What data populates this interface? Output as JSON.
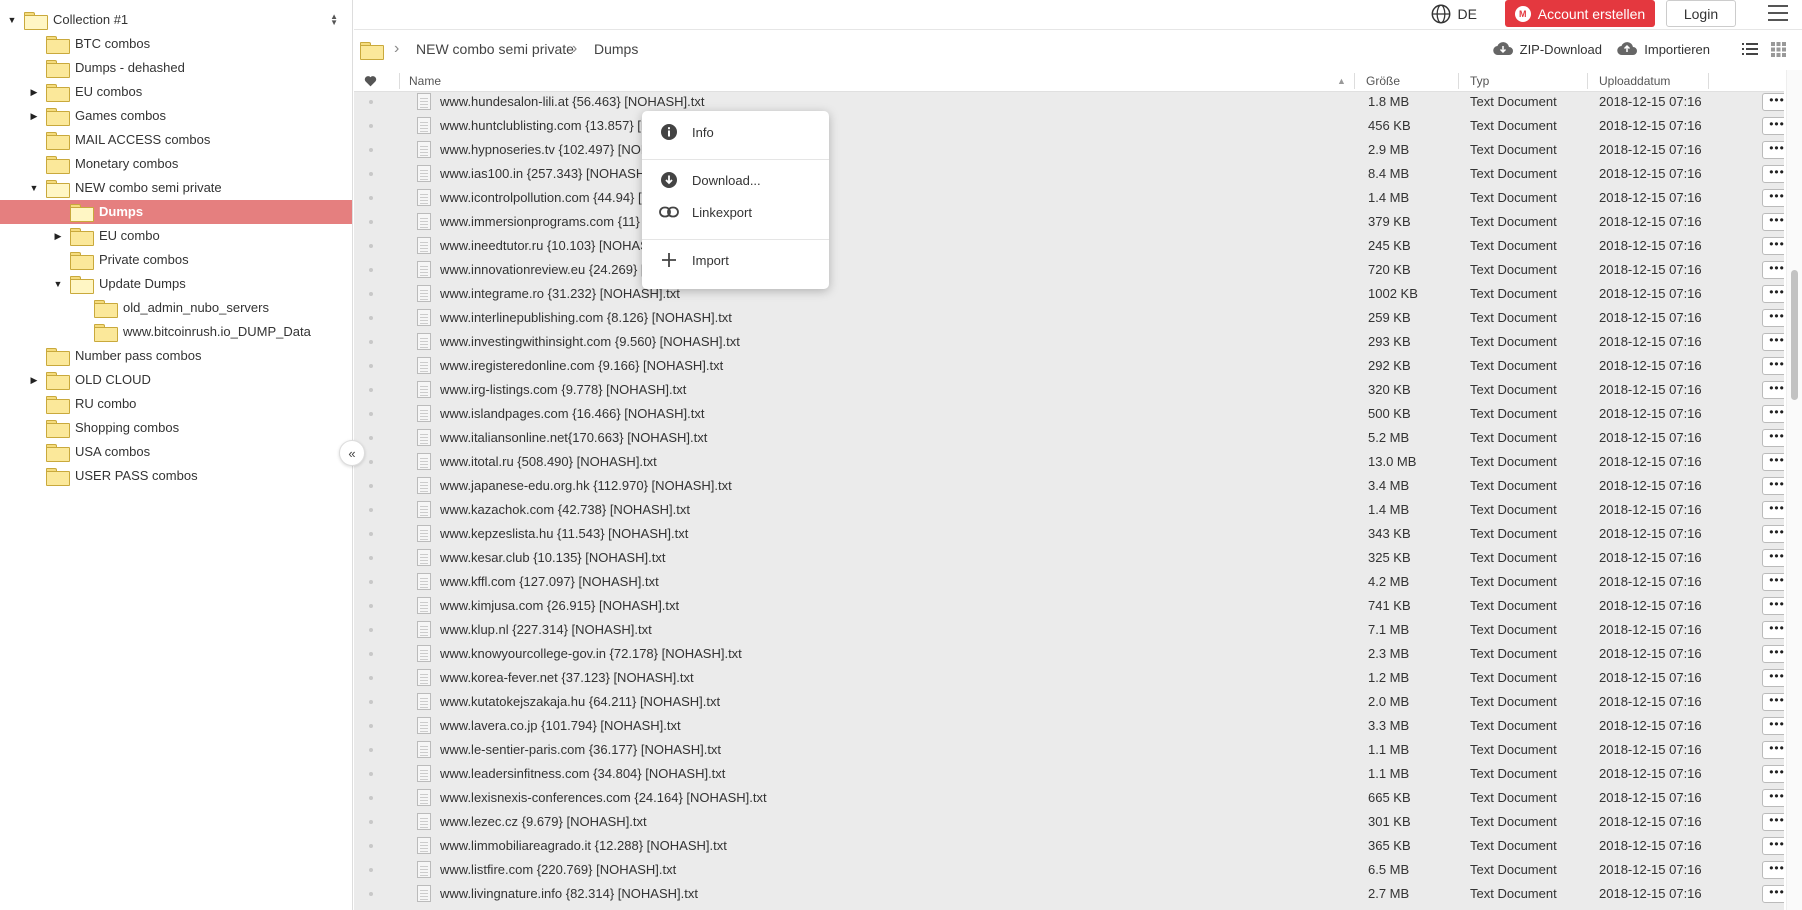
{
  "sidebar": {
    "items": [
      {
        "label": "Collection #1",
        "caret": "open",
        "open": true
      },
      {
        "label": "BTC combos"
      },
      {
        "label": "Dumps - dehashed"
      },
      {
        "label": "EU combos",
        "caret": "closed"
      },
      {
        "label": "Games combos",
        "caret": "closed"
      },
      {
        "label": "MAIL ACCESS combos"
      },
      {
        "label": "Monetary combos"
      },
      {
        "label": "NEW combo semi private",
        "caret": "open",
        "open": true
      },
      {
        "label": "Dumps",
        "open": true,
        "selected": true
      },
      {
        "label": "EU combo",
        "caret": "closed"
      },
      {
        "label": "Private combos"
      },
      {
        "label": "Update Dumps",
        "caret": "open",
        "open": true
      },
      {
        "label": "old_admin_nubo_servers"
      },
      {
        "label": "www.bitcoinrush.io_DUMP_Data"
      },
      {
        "label": "Number pass combos"
      },
      {
        "label": "OLD CLOUD",
        "caret": "closed"
      },
      {
        "label": "RU combo"
      },
      {
        "label": "Shopping combos"
      },
      {
        "label": "USA combos"
      },
      {
        "label": "USER PASS combos"
      }
    ],
    "collapse_icon": "double-chevron-left-icon"
  },
  "topbar": {
    "language": "DE",
    "account_button": "Account erstellen",
    "login_button": "Login"
  },
  "breadcrumb": {
    "items": [
      "NEW combo semi private",
      "Dumps"
    ]
  },
  "toolbar": {
    "zip_download": "ZIP-Download",
    "import": "Importieren"
  },
  "table": {
    "columns": {
      "name": "Name",
      "size": "Größe",
      "type": "Typ",
      "date": "Uploaddatum"
    },
    "rows": [
      {
        "name": "www.hundesalon-lili.at {56.463} [NOHASH].txt",
        "size": "1.8 MB",
        "type": "Text Document",
        "date": "2018-12-15 07:16"
      },
      {
        "name": "www.huntclublisting.com {13.857} [NOHASH].txt",
        "size": "456 KB",
        "type": "Text Document",
        "date": "2018-12-15 07:16"
      },
      {
        "name": "www.hypnoseries.tv {102.497} [NOHASH].txt",
        "size": "2.9 MB",
        "type": "Text Document",
        "date": "2018-12-15 07:16"
      },
      {
        "name": "www.ias100.in {257.343} [NOHASH].txt",
        "size": "8.4 MB",
        "type": "Text Document",
        "date": "2018-12-15 07:16"
      },
      {
        "name": "www.icontrolpollution.com {44.94} [NOHASH].txt",
        "size": "1.4 MB",
        "type": "Text Document",
        "date": "2018-12-15 07:16"
      },
      {
        "name": "www.immersionprograms.com {11} [NOHASH].txt",
        "size": "379 KB",
        "type": "Text Document",
        "date": "2018-12-15 07:16"
      },
      {
        "name": "www.ineedtutor.ru {10.103} [NOHASH].txt",
        "size": "245 KB",
        "type": "Text Document",
        "date": "2018-12-15 07:16"
      },
      {
        "name": "www.innovationreview.eu {24.269} [NOHASH].txt",
        "size": "720 KB",
        "type": "Text Document",
        "date": "2018-12-15 07:16"
      },
      {
        "name": "www.integrame.ro {31.232} [NOHASH].txt",
        "size": "1002 KB",
        "type": "Text Document",
        "date": "2018-12-15 07:16"
      },
      {
        "name": "www.interlinepublishing.com {8.126} [NOHASH].txt",
        "size": "259 KB",
        "type": "Text Document",
        "date": "2018-12-15 07:16"
      },
      {
        "name": "www.investingwithinsight.com {9.560} [NOHASH].txt",
        "size": "293 KB",
        "type": "Text Document",
        "date": "2018-12-15 07:16"
      },
      {
        "name": "www.iregisteredonline.com {9.166} [NOHASH].txt",
        "size": "292 KB",
        "type": "Text Document",
        "date": "2018-12-15 07:16"
      },
      {
        "name": "www.irg-listings.com {9.778} [NOHASH].txt",
        "size": "320 KB",
        "type": "Text Document",
        "date": "2018-12-15 07:16"
      },
      {
        "name": "www.islandpages.com {16.466} [NOHASH].txt",
        "size": "500 KB",
        "type": "Text Document",
        "date": "2018-12-15 07:16"
      },
      {
        "name": "www.italiansonline.net{170.663} [NOHASH].txt",
        "size": "5.2 MB",
        "type": "Text Document",
        "date": "2018-12-15 07:16"
      },
      {
        "name": "www.itotal.ru {508.490} [NOHASH].txt",
        "size": "13.0 MB",
        "type": "Text Document",
        "date": "2018-12-15 07:16"
      },
      {
        "name": "www.japanese-edu.org.hk {112.970} [NOHASH].txt",
        "size": "3.4 MB",
        "type": "Text Document",
        "date": "2018-12-15 07:16"
      },
      {
        "name": "www.kazachok.com {42.738} [NOHASH].txt",
        "size": "1.4 MB",
        "type": "Text Document",
        "date": "2018-12-15 07:16"
      },
      {
        "name": "www.kepzeslista.hu {11.543} [NOHASH].txt",
        "size": "343 KB",
        "type": "Text Document",
        "date": "2018-12-15 07:16"
      },
      {
        "name": "www.kesar.club {10.135} [NOHASH].txt",
        "size": "325 KB",
        "type": "Text Document",
        "date": "2018-12-15 07:16"
      },
      {
        "name": "www.kffl.com {127.097} [NOHASH].txt",
        "size": "4.2 MB",
        "type": "Text Document",
        "date": "2018-12-15 07:16"
      },
      {
        "name": "www.kimjusa.com {26.915} [NOHASH].txt",
        "size": "741 KB",
        "type": "Text Document",
        "date": "2018-12-15 07:16"
      },
      {
        "name": "www.klup.nl {227.314} [NOHASH].txt",
        "size": "7.1 MB",
        "type": "Text Document",
        "date": "2018-12-15 07:16"
      },
      {
        "name": "www.knowyourcollege-gov.in {72.178} [NOHASH].txt",
        "size": "2.3 MB",
        "type": "Text Document",
        "date": "2018-12-15 07:16"
      },
      {
        "name": "www.korea-fever.net {37.123} [NOHASH].txt",
        "size": "1.2 MB",
        "type": "Text Document",
        "date": "2018-12-15 07:16"
      },
      {
        "name": "www.kutatokejszakaja.hu {64.211} [NOHASH].txt",
        "size": "2.0 MB",
        "type": "Text Document",
        "date": "2018-12-15 07:16"
      },
      {
        "name": "www.lavera.co.jp {101.794} [NOHASH].txt",
        "size": "3.3 MB",
        "type": "Text Document",
        "date": "2018-12-15 07:16"
      },
      {
        "name": "www.le-sentier-paris.com {36.177} [NOHASH].txt",
        "size": "1.1 MB",
        "type": "Text Document",
        "date": "2018-12-15 07:16"
      },
      {
        "name": "www.leadersinfitness.com {34.804} [NOHASH].txt",
        "size": "1.1 MB",
        "type": "Text Document",
        "date": "2018-12-15 07:16"
      },
      {
        "name": "www.lexisnexis-conferences.com {24.164} [NOHASH].txt",
        "size": "665 KB",
        "type": "Text Document",
        "date": "2018-12-15 07:16"
      },
      {
        "name": "www.lezec.cz {9.679} [NOHASH].txt",
        "size": "301 KB",
        "type": "Text Document",
        "date": "2018-12-15 07:16"
      },
      {
        "name": "www.limmobiliareagrado.it {12.288} [NOHASH].txt",
        "size": "365 KB",
        "type": "Text Document",
        "date": "2018-12-15 07:16"
      },
      {
        "name": "www.listfire.com {220.769} [NOHASH].txt",
        "size": "6.5 MB",
        "type": "Text Document",
        "date": "2018-12-15 07:16"
      },
      {
        "name": "www.livingnature.info {82.314} [NOHASH].txt",
        "size": "2.7 MB",
        "type": "Text Document",
        "date": "2018-12-15 07:16"
      }
    ]
  },
  "context_menu": {
    "items": [
      {
        "label": "Info",
        "icon": "info-icon"
      },
      {
        "label": "Download...",
        "icon": "download-icon"
      },
      {
        "label": "Linkexport",
        "icon": "link-icon"
      },
      {
        "label": "Import",
        "icon": "plus-icon"
      }
    ]
  },
  "colors": {
    "selected": "#e57f7f",
    "account_button": "#e4383f",
    "folder": "#fbe89a"
  }
}
